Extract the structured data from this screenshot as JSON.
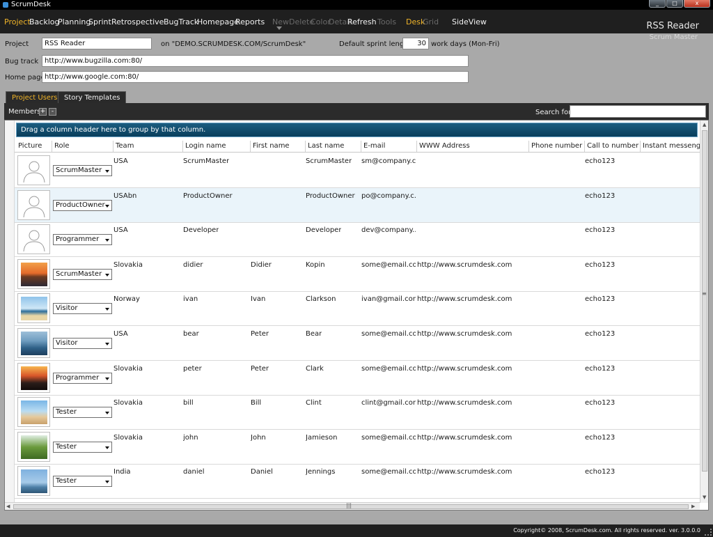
{
  "window": {
    "title": "ScrumDesk",
    "min": "_",
    "max": "□",
    "close": "x"
  },
  "menu": {
    "items": [
      "Project",
      "Backlog",
      "Planning",
      "Sprint",
      "Retrospective",
      "BugTrack",
      "Homepage",
      "Reports",
      "New",
      "Delete",
      "Color",
      "Detail",
      "Refresh",
      "Tools",
      "Desk",
      "Grid",
      "SideView"
    ]
  },
  "project_header": {
    "name": "RSS Reader",
    "role": "Scrum Master"
  },
  "settings": {
    "project_label": "Project",
    "project_value": "RSS Reader",
    "server_text": "on \"DEMO.SCRUMDESK.COM/ScrumDesk\"",
    "sprint_label": "Default sprint length",
    "sprint_value": "30",
    "sprint_unit": "work days (Mon-Fri)",
    "bugtrack_label": "Bug track",
    "bugtrack_value": "http://www.bugzilla.com:80/",
    "homepage_label": "Home page",
    "homepage_value": "http://www.google.com:80/"
  },
  "tabs": [
    "Project Users",
    "Story Templates"
  ],
  "members": {
    "label": "Members",
    "add": "+",
    "remove": "-",
    "search_label": "Search for",
    "search_value": ""
  },
  "grid": {
    "group_hint": "Drag a column header here to group by that column.",
    "columns": [
      "Picture",
      "Role",
      "Team",
      "Login name",
      "First name",
      "Last name",
      "E-mail",
      "WWW Address",
      "Phone number",
      "Call to number",
      "Instant messenger"
    ],
    "rows": [
      {
        "picture": "placeholder",
        "role": "ScrumMaster",
        "team": "USA",
        "login": "ScrumMaster",
        "first": "",
        "last": "ScrumMaster",
        "email": "sm@company.c...",
        "www": "",
        "phone": "",
        "call": "echo123"
      },
      {
        "picture": "placeholder",
        "role": "ProductOwner",
        "team": "USAbn",
        "login": "ProductOwner",
        "first": "",
        "last": "ProductOwner",
        "email": "po@company.c...",
        "www": "",
        "phone": "",
        "call": "echo123"
      },
      {
        "picture": "placeholder",
        "role": "Programmer",
        "team": "USA",
        "login": "Developer",
        "first": "",
        "last": "Developer",
        "email": "dev@company....",
        "www": "",
        "phone": "",
        "call": "echo123"
      },
      {
        "picture": "sunset",
        "role": "ScrumMaster",
        "team": "Slovakia",
        "login": "didier",
        "first": "Didier",
        "last": "Kopin",
        "email": "some@email.com",
        "www": "http://www.scrumdesk.com",
        "phone": "",
        "call": "echo123"
      },
      {
        "picture": "beach",
        "role": "Visitor",
        "team": "Norway",
        "login": "ivan",
        "first": "Ivan",
        "last": "Clarkson",
        "email": "ivan@gmail.com",
        "www": "http://www.scrumdesk.com",
        "phone": "",
        "call": "echo123"
      },
      {
        "picture": "sea",
        "role": "Visitor",
        "team": "USA",
        "login": "bear",
        "first": "Peter",
        "last": "Bear",
        "email": "some@email.com",
        "www": "http://www.scrumdesk.com",
        "phone": "",
        "call": "echo123"
      },
      {
        "picture": "dusk",
        "role": "Programmer",
        "team": "Slovakia",
        "login": "peter",
        "first": "Peter",
        "last": "Clark",
        "email": "some@email.com",
        "www": "http://www.scrumdesk.com",
        "phone": "",
        "call": "echo123"
      },
      {
        "picture": "shore",
        "role": "Tester",
        "team": "Slovakia",
        "login": "bill",
        "first": "Bill",
        "last": "Clint",
        "email": "clint@gmail.com",
        "www": "http://www.scrumdesk.com",
        "phone": "",
        "call": "echo123"
      },
      {
        "picture": "palm",
        "role": "Tester",
        "team": "Slovakia",
        "login": "john",
        "first": "John",
        "last": "Jamieson",
        "email": "some@email.com",
        "www": "http://www.scrumdesk.com",
        "phone": "",
        "call": "echo123"
      },
      {
        "picture": "cactus",
        "role": "Tester",
        "team": "India",
        "login": "daniel",
        "first": "Daniel",
        "last": "Jennings",
        "email": "some@email.com",
        "www": "http://www.scrumdesk.com",
        "phone": "",
        "call": "echo123"
      }
    ]
  },
  "footer": {
    "copyright": "Copyright© 2008, ScrumDesk.com. All rights reserved. ver. 3.0.0.0"
  },
  "colors": {
    "accent": "#f0b429",
    "menubar": "#1f1f1f",
    "group_panel": "#0b4060"
  }
}
